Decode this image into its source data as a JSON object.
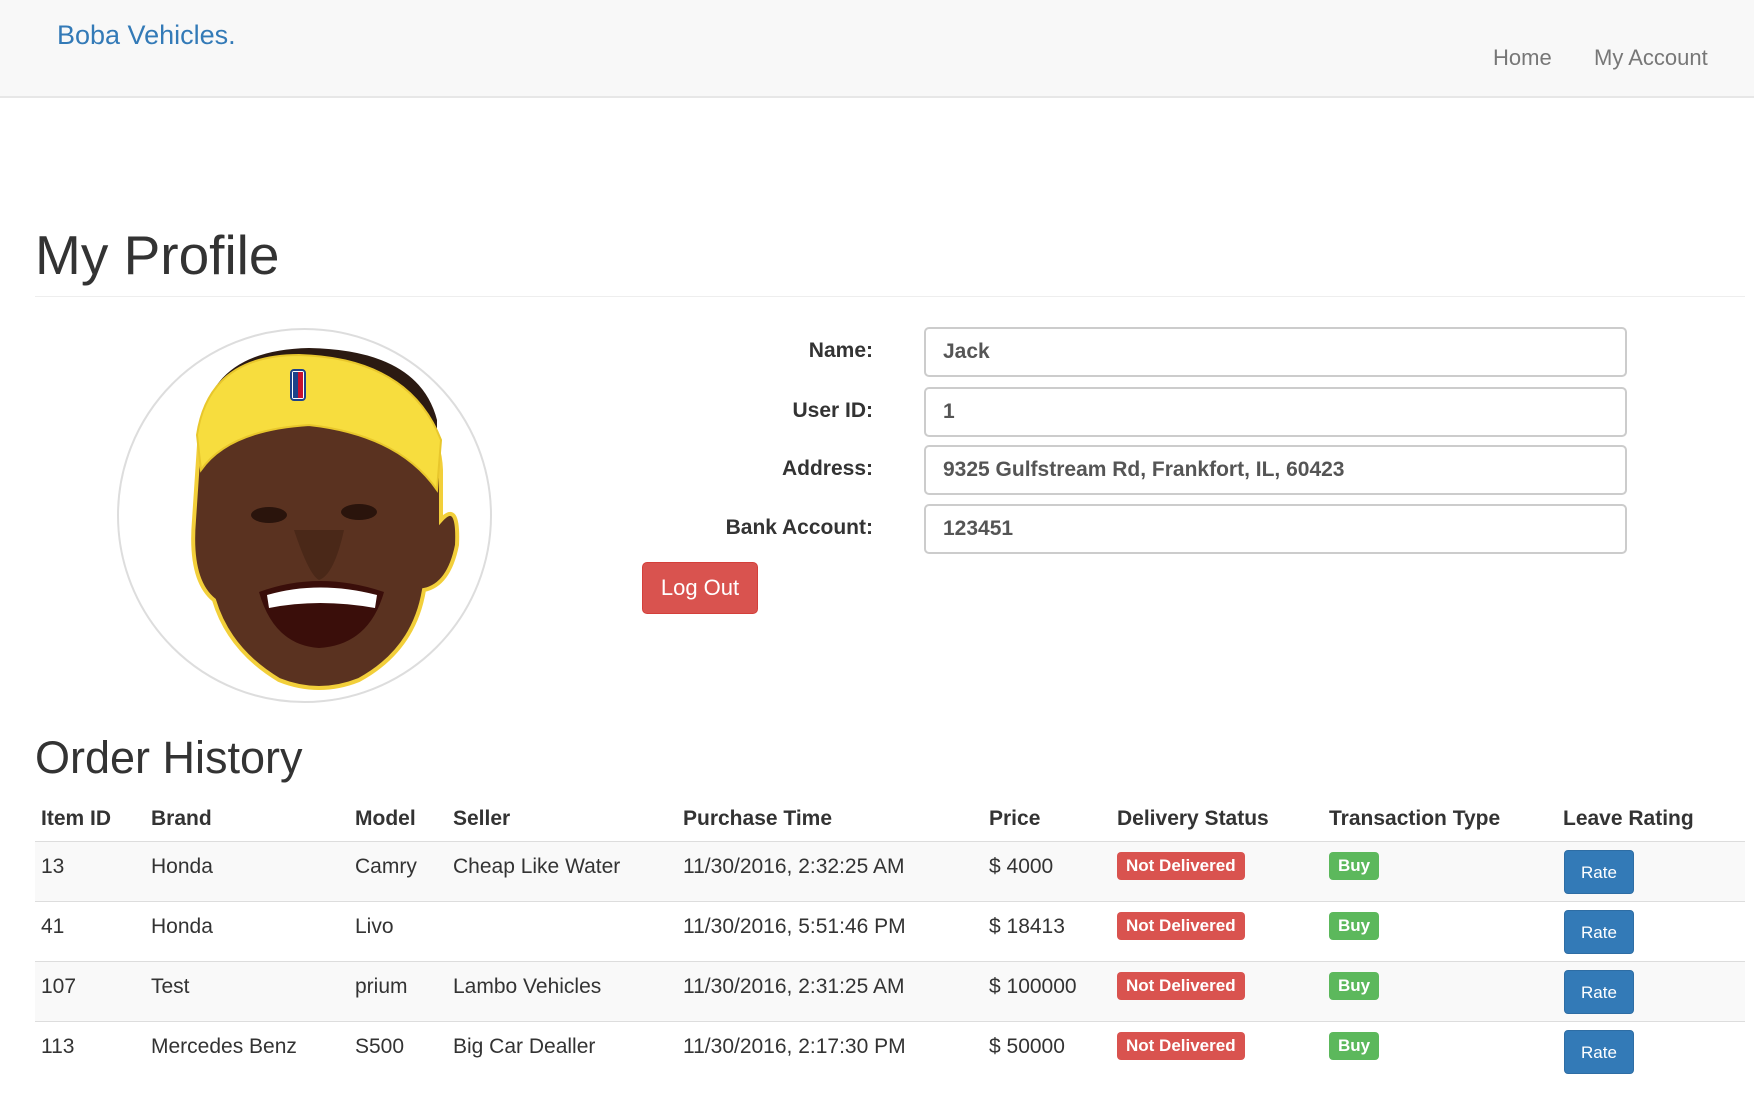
{
  "navbar": {
    "brand": "Boba Vehicles.",
    "home": "Home",
    "my_account": "My Account"
  },
  "profile": {
    "title": "My Profile",
    "fields": {
      "name_label": "Name:",
      "name_value": "Jack",
      "userid_label": "User ID:",
      "userid_value": "1",
      "address_label": "Address:",
      "address_value": "9325 Gulfstream Rd, Frankfort, IL, 60423",
      "bank_label": "Bank Account:",
      "bank_value": "123451"
    },
    "logout": "Log Out"
  },
  "orders": {
    "title": "Order History",
    "headers": [
      "Item ID",
      "Brand",
      "Model",
      "Seller",
      "Purchase Time",
      "Price",
      "Delivery Status",
      "Transaction Type",
      "Leave Rating"
    ],
    "rows": [
      {
        "id": "13",
        "brand": "Honda",
        "model": "Camry",
        "seller": "Cheap Like Water",
        "time": "11/30/2016, 2:32:25 AM",
        "price": "$ 4000",
        "status": "Not Delivered",
        "type": "Buy",
        "rate": "Rate"
      },
      {
        "id": "41",
        "brand": "Honda",
        "model": "Livo",
        "seller": "",
        "time": "11/30/2016, 5:51:46 PM",
        "price": "$ 18413",
        "status": "Not Delivered",
        "type": "Buy",
        "rate": "Rate"
      },
      {
        "id": "107",
        "brand": "Test",
        "model": "prium",
        "seller": "Lambo Vehicles",
        "time": "11/30/2016, 2:31:25 AM",
        "price": "$ 100000",
        "status": "Not Delivered",
        "type": "Buy",
        "rate": "Rate"
      },
      {
        "id": "113",
        "brand": "Mercedes Benz",
        "model": "S500",
        "seller": "Big Car Dealler",
        "time": "11/30/2016, 2:17:30 PM",
        "price": "$ 50000",
        "status": "Not Delivered",
        "type": "Buy",
        "rate": "Rate"
      }
    ]
  },
  "colors": {
    "brand": "#337ab7",
    "danger": "#d9534f",
    "success": "#5cb85c",
    "primary": "#337ab7"
  }
}
